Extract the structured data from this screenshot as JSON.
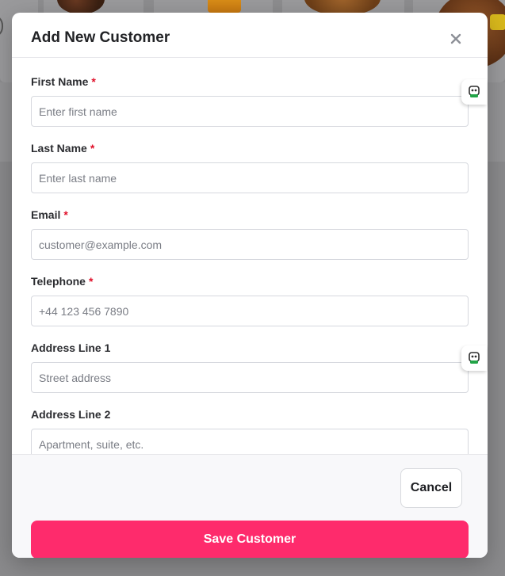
{
  "modal": {
    "title": "Add New Customer",
    "close_icon": "close-icon"
  },
  "form": {
    "required_marker": "*",
    "fields": [
      {
        "label": "First Name",
        "required": true,
        "placeholder": "Enter first name",
        "value": ""
      },
      {
        "label": "Last Name",
        "required": true,
        "placeholder": "Enter last name",
        "value": ""
      },
      {
        "label": "Email",
        "required": true,
        "placeholder": "customer@example.com",
        "value": ""
      },
      {
        "label": "Telephone",
        "required": true,
        "placeholder": "+44 123 456 7890",
        "value": ""
      },
      {
        "label": "Address Line 1",
        "required": false,
        "placeholder": "Street address",
        "value": ""
      },
      {
        "label": "Address Line 2",
        "required": false,
        "placeholder": "Apartment, suite, etc.",
        "value": ""
      }
    ]
  },
  "footer": {
    "cancel_label": "Cancel",
    "save_label": "Save Customer"
  },
  "helpers": [
    "robot-assistant-icon",
    "robot-assistant-icon"
  ],
  "colors": {
    "accent": "#fe2b6c",
    "required": "#e0102a",
    "helper_green": "#22a447"
  }
}
